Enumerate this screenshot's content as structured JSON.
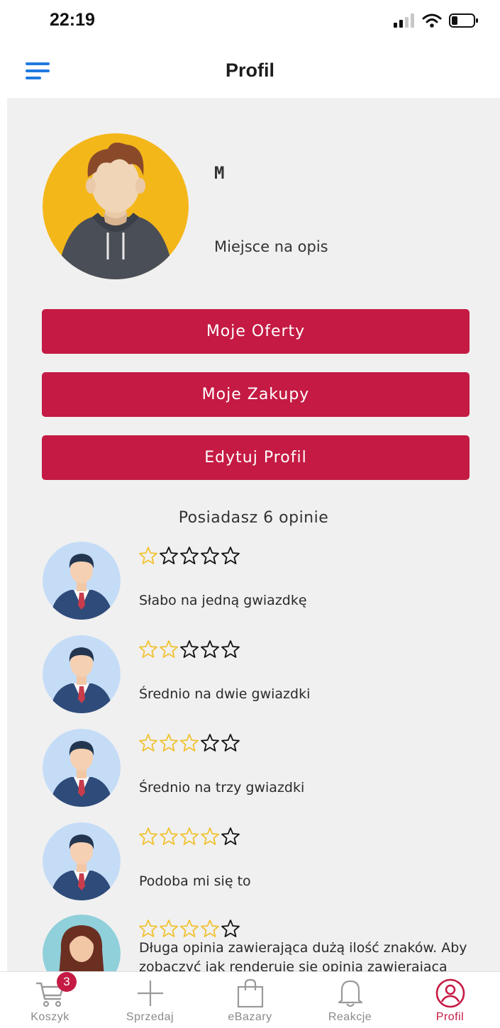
{
  "status_bar": {
    "time": "22:19"
  },
  "header": {
    "title": "Profil"
  },
  "profile": {
    "name": "M",
    "description": "Miejsce na opis"
  },
  "buttons": {
    "offers": "Moje Oferty",
    "purchases": "Moje Zakupy",
    "edit": "Edytuj Profil"
  },
  "reviews_summary": "Posiadasz 6 opinie",
  "reviews": [
    {
      "rating": 1,
      "text": "Słabo na jedną gwiazdkę"
    },
    {
      "rating": 2,
      "text": "Średnio na dwie gwiazdki"
    },
    {
      "rating": 3,
      "text": "Średnio na trzy gwiazdki"
    },
    {
      "rating": 4,
      "text": "Podoba mi się to"
    },
    {
      "rating": 4,
      "text": "Długa opinia zawierająca dużą ilość znaków. Aby zobaczyć jak renderuje się opinia zawierająca duża"
    }
  ],
  "tabs": [
    {
      "label": "Koszyk",
      "icon": "cart-icon",
      "badge": "3"
    },
    {
      "label": "Sprzedaj",
      "icon": "plus-icon"
    },
    {
      "label": "eBazary",
      "icon": "shopping-bag-icon"
    },
    {
      "label": "Reakcje",
      "icon": "bell-icon"
    },
    {
      "label": "Profil",
      "icon": "profile-icon",
      "active": true
    }
  ],
  "colors": {
    "accent": "#c41a43",
    "menu": "#1f7ae0",
    "star_filled": "#f1c232",
    "background": "#f0f0f0"
  }
}
